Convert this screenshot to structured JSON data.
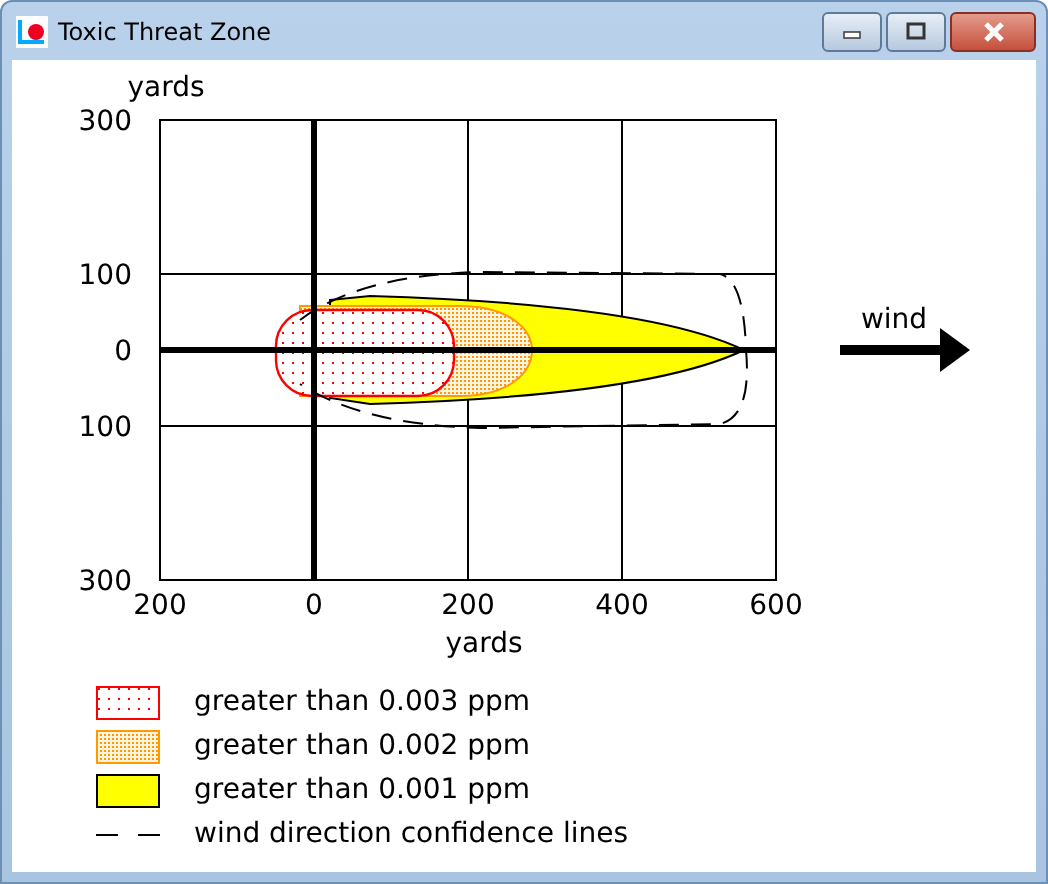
{
  "window": {
    "title": "Toxic Threat Zone"
  },
  "plot": {
    "y_unit": "yards",
    "x_unit": "yards",
    "y_ticks": [
      "300",
      "100",
      "0",
      "100",
      "300"
    ],
    "x_ticks": [
      "200",
      "0",
      "200",
      "400",
      "600"
    ],
    "wind_label": "wind"
  },
  "legend": [
    {
      "kind": "dotted",
      "color": "#ff0000",
      "label": "greater than 0.003 ppm"
    },
    {
      "kind": "dense",
      "color": "#ff9900",
      "label": "greater than 0.002 ppm"
    },
    {
      "kind": "solid",
      "color": "#ffff00",
      "label": "greater than 0.001 ppm"
    },
    {
      "kind": "dashed",
      "label": "wind direction confidence lines"
    }
  ]
}
